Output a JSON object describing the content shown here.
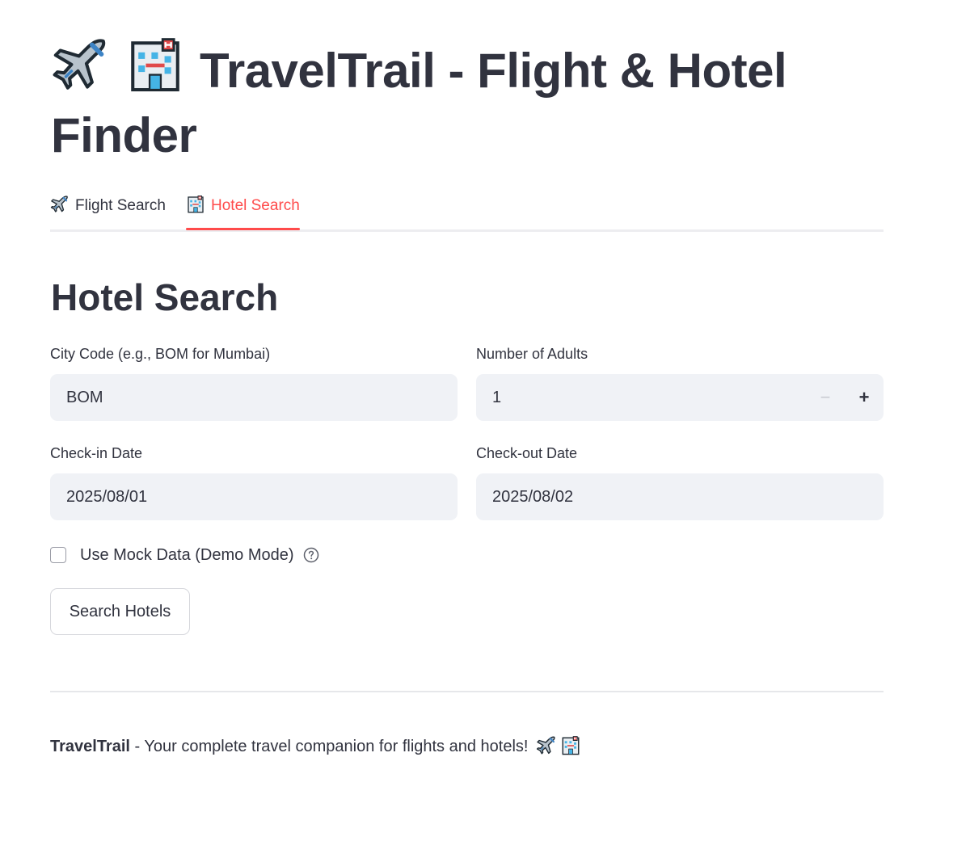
{
  "app": {
    "title": "TravelTrail - Flight & Hotel Finder",
    "icons": [
      "airplane-icon",
      "hotel-icon"
    ]
  },
  "tabs": [
    {
      "label": "Flight Search",
      "icon": "airplane-icon",
      "active": false
    },
    {
      "label": "Hotel Search",
      "icon": "hotel-icon",
      "active": true
    }
  ],
  "colors": {
    "accent": "#ff4b4b",
    "text": "#31333f",
    "input_bg": "#f0f2f6",
    "border": "#d6d7dc"
  },
  "hotel_search": {
    "heading": "Hotel Search",
    "city_code": {
      "label": "City Code (e.g., BOM for Mumbai)",
      "value": "BOM"
    },
    "adults": {
      "label": "Number of Adults",
      "value": "1",
      "minus": "−",
      "plus": "+"
    },
    "checkin": {
      "label": "Check-in Date",
      "value": "2025/08/01"
    },
    "checkout": {
      "label": "Check-out Date",
      "value": "2025/08/02"
    },
    "mock_data": {
      "label": "Use Mock Data (Demo Mode)",
      "checked": false,
      "help_icon": "question-circle-icon"
    },
    "search_button": "Search Hotels"
  },
  "footer": {
    "brand": "TravelTrail",
    "text": " - Your complete travel companion for flights and hotels!",
    "icons": [
      "airplane-icon",
      "hotel-icon"
    ]
  }
}
